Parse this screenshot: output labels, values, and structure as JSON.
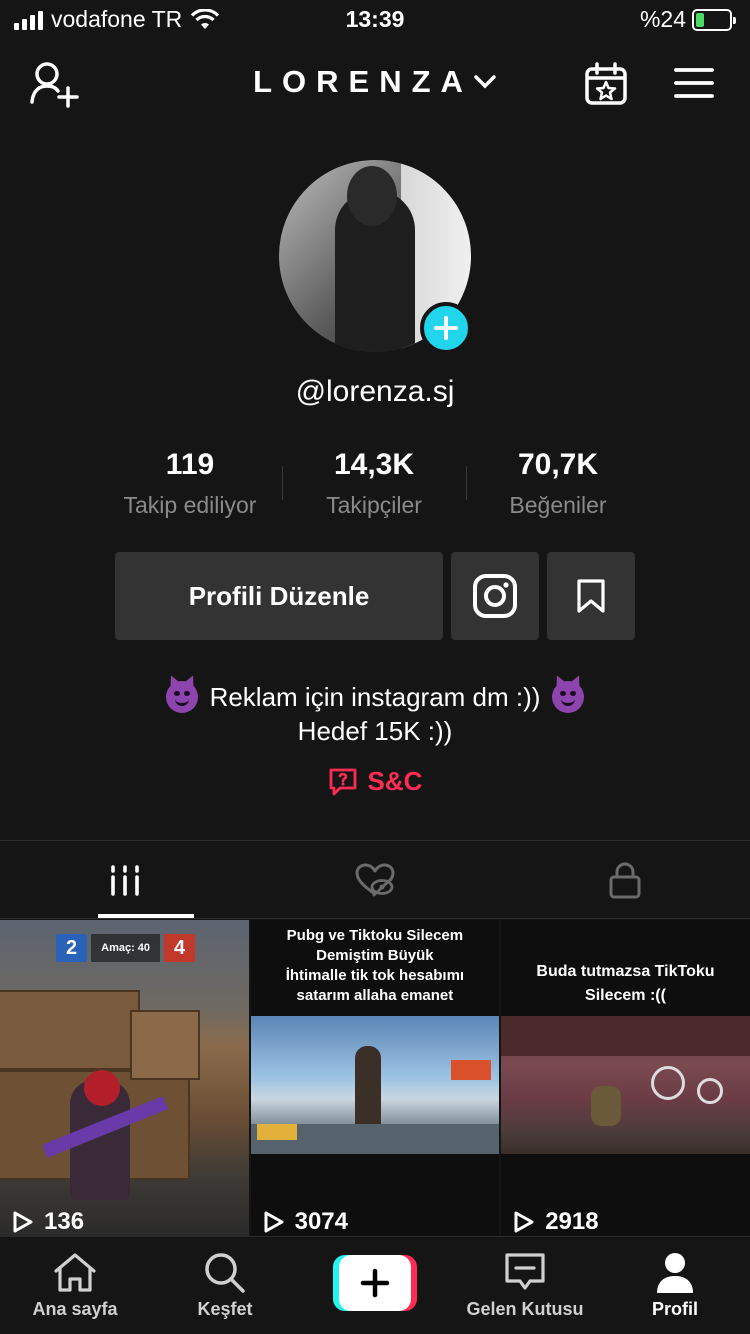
{
  "status_bar": {
    "carrier": "vodafone TR",
    "time": "13:39",
    "battery_percent": "%24",
    "battery_level": 0.24
  },
  "header": {
    "title": "LORENZA",
    "icons": [
      "add-user-icon",
      "chevron-down-icon",
      "calendar-star-icon",
      "menu-icon"
    ]
  },
  "profile": {
    "username": "@lorenza.sj",
    "stats": [
      {
        "value": "119",
        "label": "Takip ediliyor"
      },
      {
        "value": "14,3K",
        "label": "Takipçiler"
      },
      {
        "value": "70,7K",
        "label": "Beğeniler"
      }
    ],
    "edit_button": "Profili Düzenle",
    "bio_line_1": "Reklam için instagram dm :))",
    "bio_line_2": "Hedef 15K :))",
    "qa_label": "S&C"
  },
  "tabs": [
    {
      "icon": "videos-grid-icon",
      "active": true
    },
    {
      "icon": "liked-hidden-icon",
      "active": false
    },
    {
      "icon": "lock-icon",
      "active": false
    }
  ],
  "videos": [
    {
      "caption_lines": [],
      "plays": "136",
      "overlay_score": [
        "2",
        "Amaç: 40",
        "4"
      ]
    },
    {
      "caption_lines": [
        "Pubg ve Tiktoku Silecem",
        "Demiştim Büyük",
        "İhtimalle tik tok hesabımı",
        "satarım allaha emanet"
      ],
      "plays": "3074"
    },
    {
      "caption_lines": [
        "Buda tutmazsa TikToku",
        "Silecem :(("
      ],
      "plays": "2918"
    }
  ],
  "bottom_nav": [
    {
      "label": "Ana sayfa",
      "icon": "home-icon"
    },
    {
      "label": "Keşfet",
      "icon": "search-icon"
    },
    {
      "label": "",
      "icon": "create-plus-icon"
    },
    {
      "label": "Gelen Kutusu",
      "icon": "inbox-icon"
    },
    {
      "label": "Profil",
      "icon": "profile-icon",
      "active": true
    }
  ],
  "colors": {
    "background": "#151515",
    "accent_cyan": "#20d5ec",
    "accent_red": "#fe2c55",
    "button_bg": "#333333"
  }
}
